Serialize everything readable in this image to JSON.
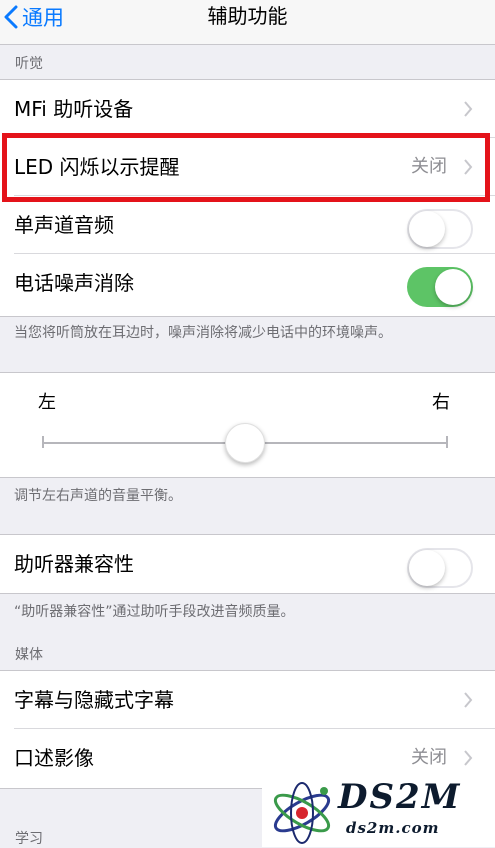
{
  "nav": {
    "back_label": "通用",
    "title": "辅助功能"
  },
  "sections": {
    "hearing_header": "听觉",
    "media_header": "媒体",
    "learning_header": "学习"
  },
  "hearing": {
    "mfi": {
      "label": "MFi 助听设备"
    },
    "led": {
      "label": "LED 闪烁以示提醒",
      "value": "关闭"
    },
    "mono": {
      "label": "单声道音频",
      "on": false
    },
    "noise": {
      "label": "电话噪声消除",
      "on": true
    },
    "noise_footer": "当您将听筒放在耳边时，噪声消除将减少电话中的环境噪声。"
  },
  "balance": {
    "left": "左",
    "right": "右",
    "level": 0.5,
    "footer": "调节左右声道的音量平衡。"
  },
  "hac": {
    "label": "助听器兼容性",
    "on": false,
    "footer": "“助听器兼容性”通过助听手段改进音频质量。"
  },
  "media": {
    "captions": {
      "label": "字幕与隐藏式字幕"
    },
    "audio_desc": {
      "label": "口述影像",
      "value": "关闭"
    }
  },
  "watermark": {
    "big": "DS2M",
    "small": "ds2m.com"
  },
  "colors": {
    "accent": "#0a7aff",
    "toggle_on": "#5dc466",
    "highlight": "#e4131a",
    "background": "#efeff4"
  }
}
